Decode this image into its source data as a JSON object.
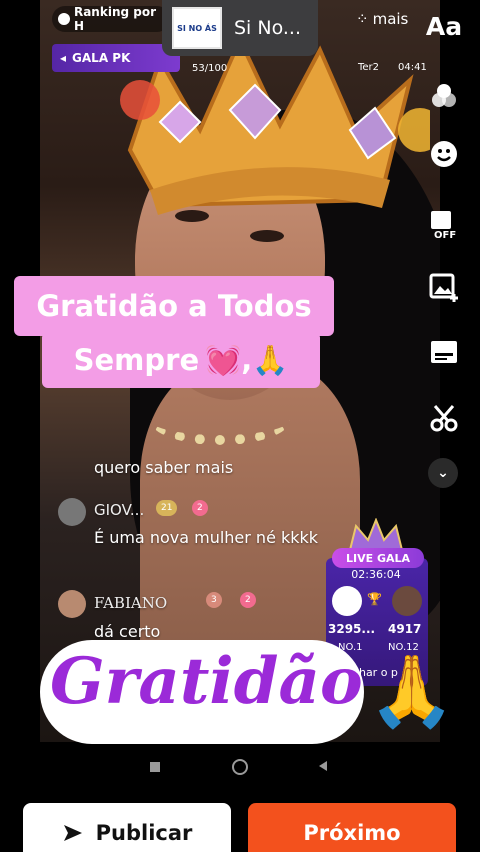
{
  "top_bar": {
    "ranking_label": "Ranking por H",
    "notification_title": "Si No...",
    "notification_logo_text": "SI NO ÁS",
    "mais_label": "mais",
    "gala_pk_label": "GALA PK",
    "score": "53/100",
    "ter_label": "Ter2",
    "time": "04:41"
  },
  "toolbar": {
    "text_label": "Aa",
    "items": [
      "text-tool",
      "filters-icon",
      "face-sticker-icon",
      "image-off-icon",
      "image-add-icon",
      "subtitle-icon",
      "scissors-icon",
      "chevron-down-icon"
    ]
  },
  "caption": {
    "line1": "Gratidão a Todos",
    "line2": "Sempre",
    "line2_emoji": "💓,🙏"
  },
  "chat": {
    "partial_message": "quero saber mais",
    "messages": [
      {
        "user": "GIOV...",
        "level": "21",
        "gift": "2",
        "text": "É uma nova mulher né kkkk"
      },
      {
        "user": "FABIANO",
        "level": "3",
        "gift": "2",
        "text": "dá certo"
      }
    ]
  },
  "live_gala": {
    "title": "LIVE GALA",
    "countdown": "02:36:04",
    "left_score": "3295...",
    "right_score": "4917",
    "left_rank": "NO.1",
    "right_rank": "NO.12",
    "partial_text": "nhar o p"
  },
  "big_caption": {
    "text": "Gratidão",
    "emoji": "🙏"
  },
  "buttons": {
    "publicar": "Publicar",
    "proximo": "Próximo"
  },
  "colors": {
    "caption_bg": "#f39de6",
    "gratidao_text": "#9b2ad8",
    "proximo_bg": "#f3511d"
  }
}
